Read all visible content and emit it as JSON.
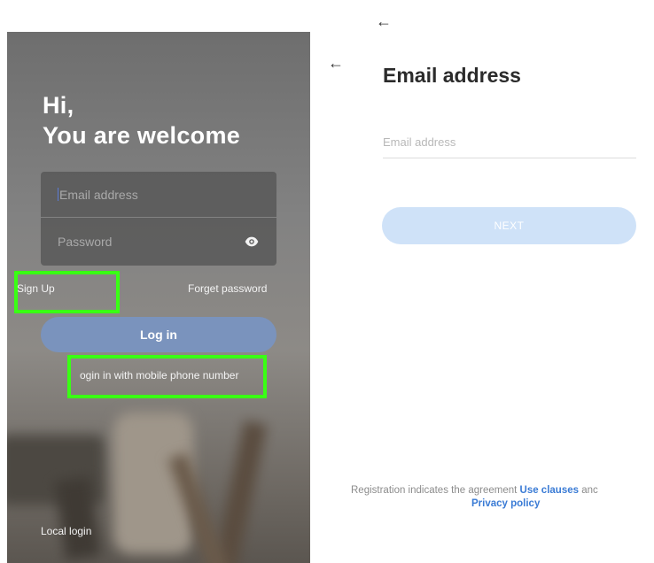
{
  "colors": {
    "accent": "#3a7bd5",
    "highlight": "#39ff14",
    "login_button": "#7a93bd",
    "next_button": "#cfe2f8"
  },
  "login_screen": {
    "greeting_line1": "Hi,",
    "greeting_line2": "You are welcome",
    "email_placeholder": "Email address",
    "password_placeholder": "Password",
    "password_toggle_icon": "eye-icon",
    "sign_up": "Sign Up",
    "forget_password": "Forget password",
    "login_button": "Log in",
    "mobile_login": "ogin in with mobile phone number",
    "local_login": "Local login"
  },
  "email_screen": {
    "back_icon": "arrow-left-icon",
    "title": "Email address",
    "email_placeholder": "Email address",
    "next_button": "NEXT",
    "agreement_prefix": "Registration indicates the agreement",
    "use_clauses": "Use clauses",
    "and_text": "anc",
    "privacy_policy": "Privacy policy"
  }
}
